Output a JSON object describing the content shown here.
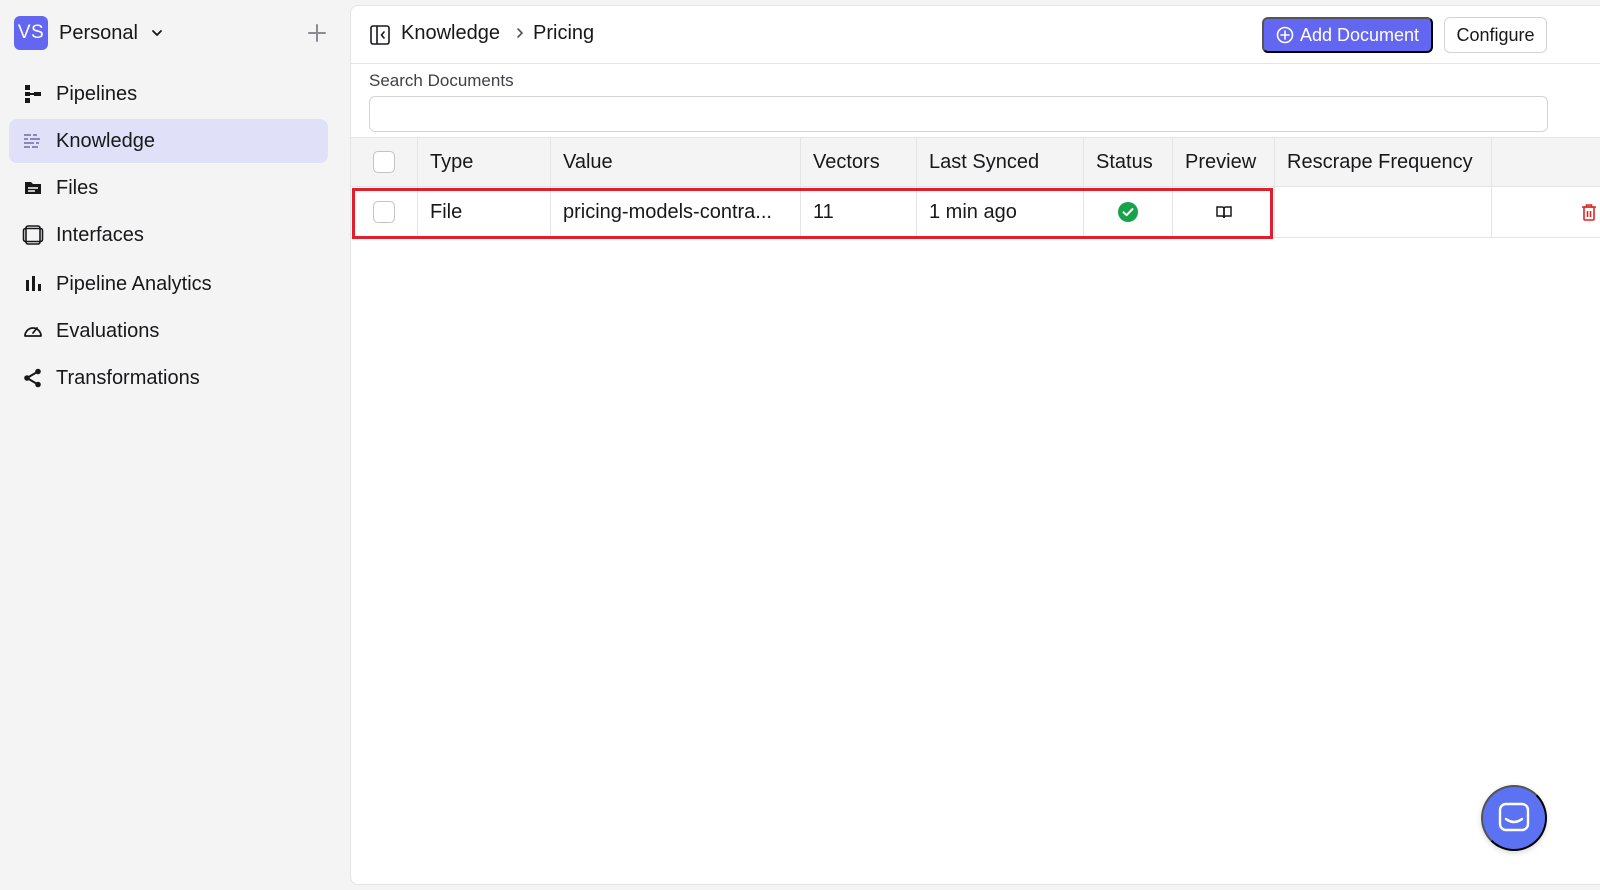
{
  "workspace": {
    "initials": "VS",
    "name": "Personal"
  },
  "sidebar": {
    "items": [
      {
        "label": "Pipelines",
        "icon": "pipeline-icon"
      },
      {
        "label": "Knowledge",
        "icon": "knowledge-icon",
        "active": true
      },
      {
        "label": "Files",
        "icon": "folder-icon"
      },
      {
        "label": "Interfaces",
        "icon": "interfaces-icon"
      },
      {
        "label": "Pipeline Analytics",
        "icon": "bar-chart-icon"
      },
      {
        "label": "Evaluations",
        "icon": "gauge-icon"
      },
      {
        "label": "Transformations",
        "icon": "share-icon"
      }
    ]
  },
  "breadcrumb": {
    "parent": "Knowledge",
    "current": "Pricing"
  },
  "toolbar": {
    "add_label": "Add Document",
    "configure_label": "Configure"
  },
  "search": {
    "label": "Search Documents",
    "value": "",
    "placeholder": ""
  },
  "table": {
    "headers": {
      "type": "Type",
      "value": "Value",
      "vectors": "Vectors",
      "last_synced": "Last Synced",
      "status": "Status",
      "preview": "Preview",
      "rescrape": "Rescrape Frequency"
    },
    "rows": [
      {
        "type": "File",
        "value": "pricing-models-contra...",
        "vectors": "11",
        "last_synced": "1 min ago",
        "status": "success",
        "rescrape": ""
      }
    ]
  },
  "colors": {
    "accent": "#6366f1",
    "active_nav": "#e0e1f8",
    "status_success": "#16a34a",
    "delete": "#dc2626",
    "highlight": "#e11d2e",
    "chat": "#5b73f2"
  }
}
